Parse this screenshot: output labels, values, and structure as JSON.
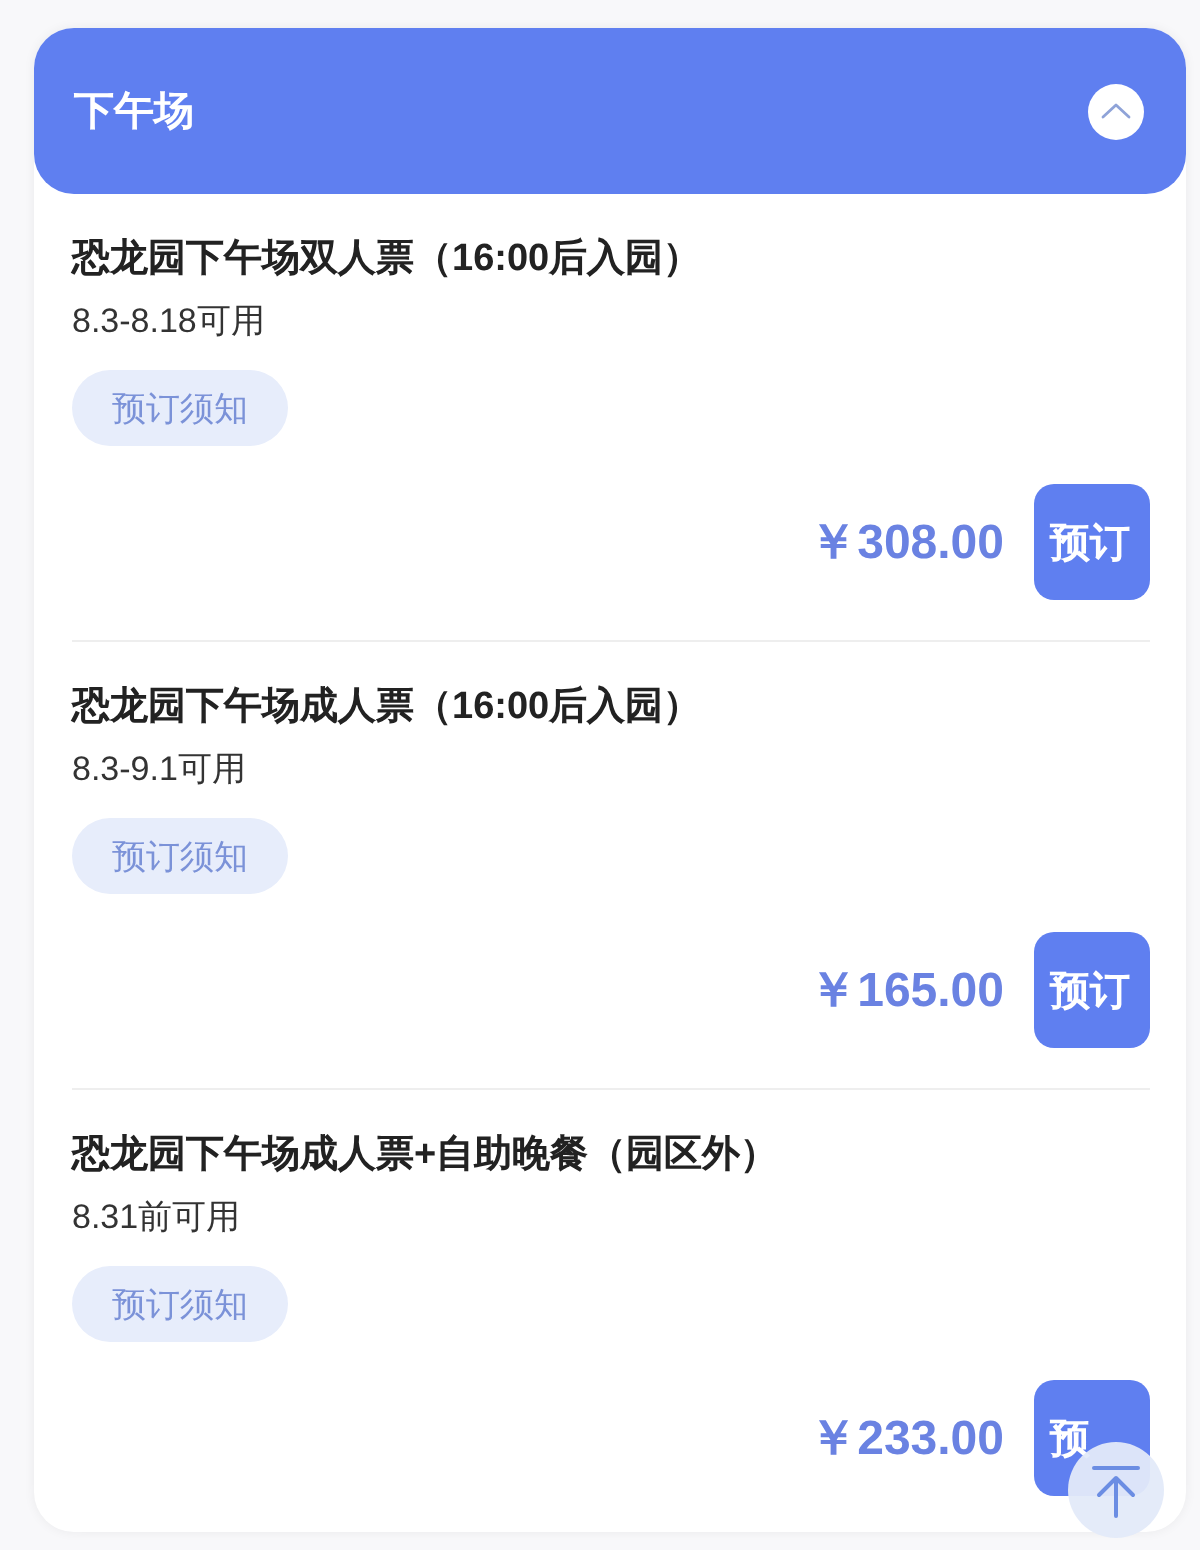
{
  "section": {
    "title": "下午场",
    "expanded": true
  },
  "tickets": [
    {
      "name": "恐龙园下午场双人票（16:00后入园）",
      "validity": "8.3-8.18可用",
      "notice_label": "预订须知",
      "price": "￥308.00",
      "book_label": "预订"
    },
    {
      "name": "恐龙园下午场成人票（16:00后入园）",
      "validity": "8.3-9.1可用",
      "notice_label": "预订须知",
      "price": "￥165.00",
      "book_label": "预订"
    },
    {
      "name": "恐龙园下午场成人票+自助晚餐（园区外）",
      "validity": "8.31前可用",
      "notice_label": "预订须知",
      "price": "￥233.00",
      "book_label": "预"
    }
  ]
}
